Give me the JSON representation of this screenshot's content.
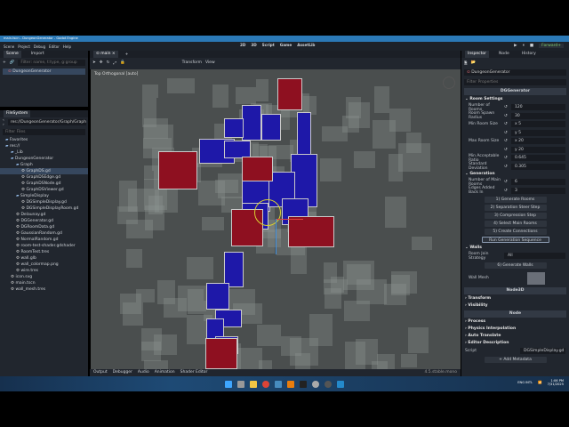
{
  "window": {
    "title": "main.tscn - DungeonGenerator - Godot Engine"
  },
  "menu": [
    "Scene",
    "Project",
    "Debug",
    "Editor",
    "Help"
  ],
  "workspaces": [
    "2D",
    "3D",
    "Script",
    "Game",
    "AssetLib"
  ],
  "renderer": "Forward+",
  "scene_dock": {
    "tabs": [
      "Scene",
      "Import"
    ],
    "filter_placeholder": "Filter: name, t:type, g:group",
    "root": "DungeonGenerator"
  },
  "filesystem": {
    "title": "FileSystem",
    "path": "res://DungeonGenerator/Graph/Graph",
    "filter_placeholder": "Filter Files",
    "items": [
      {
        "n": "Favorites",
        "d": 0
      },
      {
        "n": "res://",
        "d": 0
      },
      {
        "n": "_Lib",
        "d": 1
      },
      {
        "n": "DungeonGenerator",
        "d": 1
      },
      {
        "n": "Graph",
        "d": 2
      },
      {
        "n": "GraphDS.gd",
        "d": 3,
        "sel": true
      },
      {
        "n": "GraphDSEdge.gd",
        "d": 3
      },
      {
        "n": "GraphDSNode.gd",
        "d": 3
      },
      {
        "n": "GraphDSViewer.gd",
        "d": 3
      },
      {
        "n": "SimpleDisplay",
        "d": 2
      },
      {
        "n": "DGSimpleDisplay.gd",
        "d": 3
      },
      {
        "n": "DGSimpleDisplayRoom.gd",
        "d": 3
      },
      {
        "n": "Delaunay.gd",
        "d": 2
      },
      {
        "n": "DGGenerator.gd",
        "d": 2
      },
      {
        "n": "DGRoomData.gd",
        "d": 2
      },
      {
        "n": "GaussianRandom.gd",
        "d": 2
      },
      {
        "n": "NormalRandom.gd",
        "d": 2
      },
      {
        "n": "room-test-shader.gdshader",
        "d": 2
      },
      {
        "n": "RoomTest.tres",
        "d": 2
      },
      {
        "n": "wall.glb",
        "d": 2
      },
      {
        "n": "wall_colormap.png",
        "d": 2
      },
      {
        "n": "wire.tres",
        "d": 2
      },
      {
        "n": "icon.svg",
        "d": 1
      },
      {
        "n": "main.tscn",
        "d": 1
      },
      {
        "n": "wall_mesh.tres",
        "d": 1
      }
    ]
  },
  "editor": {
    "tab": "main",
    "toolbar": [
      "Transform",
      "View"
    ],
    "viewport_label": "Top Orthogonal [auto]"
  },
  "bottom_panel": {
    "tabs": [
      "Output",
      "Debugger",
      "Audio",
      "Animation",
      "Shader Editor"
    ],
    "version": "4.5.stable.mono"
  },
  "inspector": {
    "tabs": [
      "Inspector",
      "Node",
      "History"
    ],
    "object": "DungeonGenerator",
    "filter_placeholder": "Filter Properties",
    "class_header": "DGGenerator",
    "room_settings": {
      "title": "Room Settings",
      "props": [
        [
          "Number of Rooms",
          "120"
        ],
        [
          "Room Spawn Radius",
          "30"
        ],
        [
          "Min Room Size",
          "x 5"
        ],
        [
          "",
          "y 5"
        ],
        [
          "Max Room Size",
          "x 20"
        ],
        [
          "",
          "y 20"
        ],
        [
          "Min Acceptable Ratio",
          "0.645"
        ],
        [
          "Standard Deviation",
          "0.305"
        ]
      ]
    },
    "generation": {
      "title": "Generation",
      "props": [
        [
          "Number of Main Rooms",
          "6"
        ],
        [
          "Edges Added Back In",
          "3"
        ]
      ],
      "buttons": [
        "1) Generate Rooms",
        "2) Separation Steer Step",
        "3) Compression Step",
        "4) Select Main Rooms",
        "5) Create Connections",
        "Run Generation Sequence"
      ]
    },
    "walls": {
      "title": "Walls",
      "join_label": "Room Join Strategy",
      "join_value": "All",
      "button": "6) Generate Walls",
      "mesh_label": "Wall Mesh"
    },
    "node3d": "Node3D",
    "node3d_sections": [
      "Transform",
      "Visibility"
    ],
    "node": "Node",
    "node_sections": [
      "Process",
      "Physics Interpolation",
      "Auto Translate",
      "Editor Description"
    ],
    "script_label": "Script",
    "script_value": "DGSimpleDisplay.gd",
    "add_metadata": "Add Metadata"
  },
  "tray": {
    "lang": "ENG INTL",
    "time": "1:06 PM",
    "date": "7/31/2025"
  },
  "colors": {
    "accent": "#2b79b6",
    "main_room": "#8e1020",
    "corridor_room": "#1e18a8"
  }
}
